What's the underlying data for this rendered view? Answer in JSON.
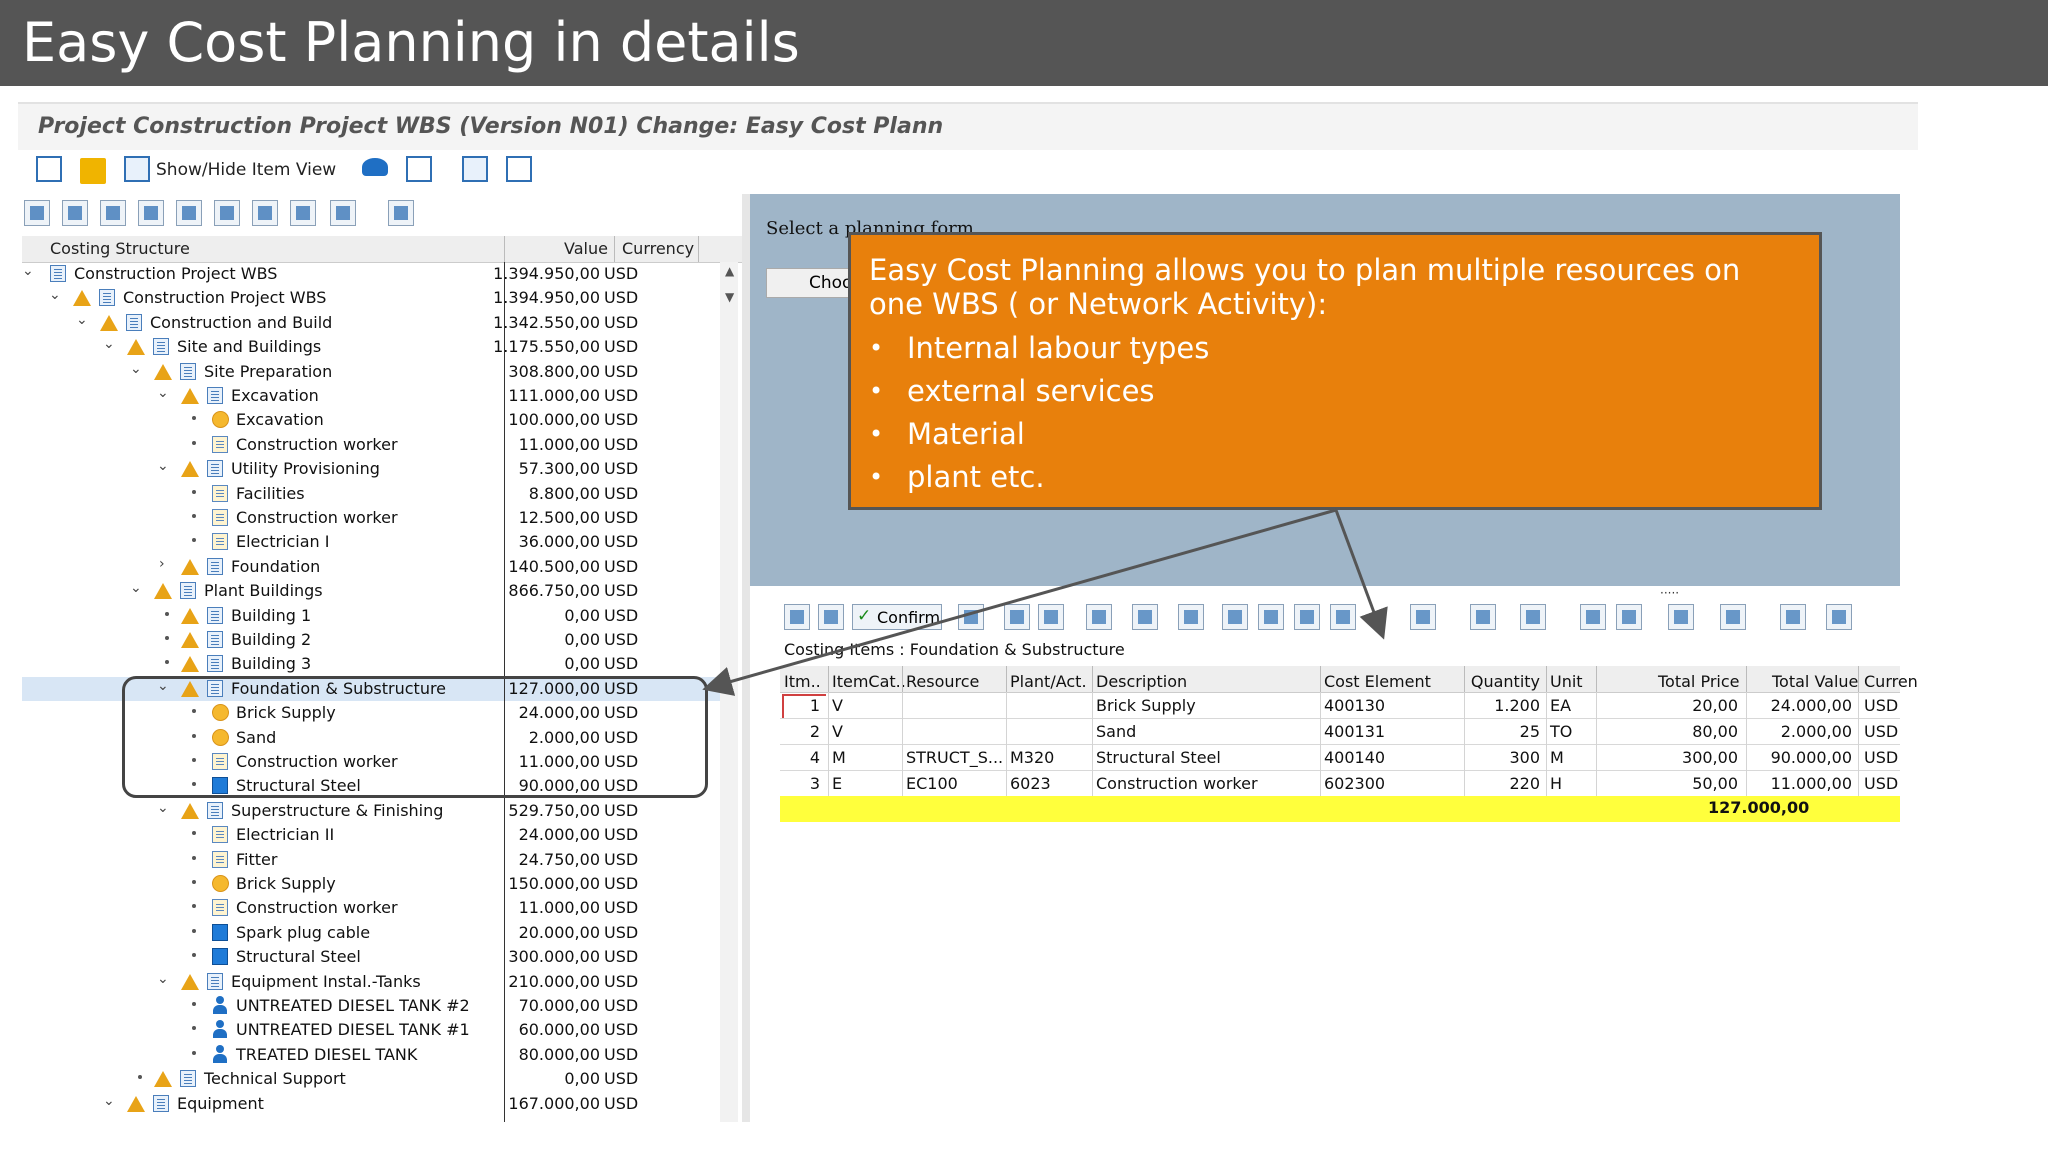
{
  "slide": {
    "title": "Easy Cost Planning in details"
  },
  "window": {
    "title": "Project Construction Project WBS (Version N01) Change: Easy Cost Plann"
  },
  "toolbar": {
    "show_hide_label": "Show/Hide Item View"
  },
  "tree": {
    "headers": {
      "structure": "Costing Structure",
      "value": "Value",
      "currency": "Currency"
    },
    "rows": [
      {
        "label": "Construction Project WBS",
        "value": "1.394.950,00",
        "currency": "USD"
      },
      {
        "label": "Construction Project WBS",
        "value": "1.394.950,00",
        "currency": "USD"
      },
      {
        "label": "Construction and Build",
        "value": "1.342.550,00",
        "currency": "USD"
      },
      {
        "label": "Site and Buildings",
        "value": "1.175.550,00",
        "currency": "USD"
      },
      {
        "label": "Site Preparation",
        "value": "308.800,00",
        "currency": "USD"
      },
      {
        "label": "Excavation",
        "value": "111.000,00",
        "currency": "USD"
      },
      {
        "label": "Excavation",
        "value": "100.000,00",
        "currency": "USD"
      },
      {
        "label": "Construction worker",
        "value": "11.000,00",
        "currency": "USD"
      },
      {
        "label": "Utility Provisioning",
        "value": "57.300,00",
        "currency": "USD"
      },
      {
        "label": "Facilities",
        "value": "8.800,00",
        "currency": "USD"
      },
      {
        "label": "Construction worker",
        "value": "12.500,00",
        "currency": "USD"
      },
      {
        "label": "Electrician I",
        "value": "36.000,00",
        "currency": "USD"
      },
      {
        "label": "Foundation",
        "value": "140.500,00",
        "currency": "USD"
      },
      {
        "label": "Plant Buildings",
        "value": "866.750,00",
        "currency": "USD"
      },
      {
        "label": "Building 1",
        "value": "0,00",
        "currency": "USD"
      },
      {
        "label": "Building 2",
        "value": "0,00",
        "currency": "USD"
      },
      {
        "label": "Building 3",
        "value": "0,00",
        "currency": "USD"
      },
      {
        "label": "Foundation & Substructure",
        "value": "127.000,00",
        "currency": "USD"
      },
      {
        "label": "Brick Supply",
        "value": "24.000,00",
        "currency": "USD"
      },
      {
        "label": "Sand",
        "value": "2.000,00",
        "currency": "USD"
      },
      {
        "label": "Construction worker",
        "value": "11.000,00",
        "currency": "USD"
      },
      {
        "label": "Structural Steel",
        "value": "90.000,00",
        "currency": "USD"
      },
      {
        "label": "Superstructure & Finishing",
        "value": "529.750,00",
        "currency": "USD"
      },
      {
        "label": "Electrician II",
        "value": "24.000,00",
        "currency": "USD"
      },
      {
        "label": "Fitter",
        "value": "24.750,00",
        "currency": "USD"
      },
      {
        "label": "Brick Supply",
        "value": "150.000,00",
        "currency": "USD"
      },
      {
        "label": "Construction worker",
        "value": "11.000,00",
        "currency": "USD"
      },
      {
        "label": "Spark plug cable",
        "value": "20.000,00",
        "currency": "USD"
      },
      {
        "label": "Structural Steel",
        "value": "300.000,00",
        "currency": "USD"
      },
      {
        "label": "Equipment Instal.-Tanks",
        "value": "210.000,00",
        "currency": "USD"
      },
      {
        "label": "UNTREATED DIESEL TANK #2",
        "value": "70.000,00",
        "currency": "USD"
      },
      {
        "label": "UNTREATED DIESEL TANK #1",
        "value": "60.000,00",
        "currency": "USD"
      },
      {
        "label": "TREATED DIESEL TANK",
        "value": "80.000,00",
        "currency": "USD"
      },
      {
        "label": "Technical Support",
        "value": "0,00",
        "currency": "USD"
      },
      {
        "label": "Equipment",
        "value": "167.000,00",
        "currency": "USD"
      }
    ]
  },
  "planning_form": {
    "prompt": "Select a planning form",
    "choose_label": "Choo"
  },
  "items_toolbar": {
    "confirm_label": "Confirm"
  },
  "costing_items": {
    "caption": "Costing Items  : Foundation & Substructure",
    "headers": [
      "Itm..",
      "ItemCat..",
      "Resource",
      "Plant/Act.",
      "Description",
      "Cost Element",
      "Quantity",
      "Unit",
      "Total Price",
      "Total Value",
      "Curren"
    ],
    "rows": [
      [
        "1",
        "V",
        "",
        "",
        "Brick Supply",
        "400130",
        "1.200",
        "EA",
        "20,00",
        "24.000,00",
        "USD"
      ],
      [
        "2",
        "V",
        "",
        "",
        "Sand",
        "400131",
        "25",
        "TO",
        "80,00",
        "2.000,00",
        "USD"
      ],
      [
        "4",
        "M",
        "STRUCT_S...",
        "M320",
        "Structural Steel",
        "400140",
        "300",
        "M",
        "300,00",
        "90.000,00",
        "USD"
      ],
      [
        "3",
        "E",
        "EC100",
        "6023",
        "Construction worker",
        "602300",
        "220",
        "H",
        "50,00",
        "11.000,00",
        "USD"
      ]
    ],
    "total": "127.000,00"
  },
  "callout": {
    "text": "Easy Cost Planning allows you to plan multiple resources on one WBS ( or  Network Activity):",
    "bullets": [
      "Internal labour types",
      "external services",
      "Material",
      "plant etc."
    ],
    "color": "#e8800c"
  },
  "colors": {
    "header_bar": "#555555",
    "selected_row": "#d8e6f5",
    "total_row": "#ffff3c",
    "top_panel": "#9fb5c8"
  }
}
